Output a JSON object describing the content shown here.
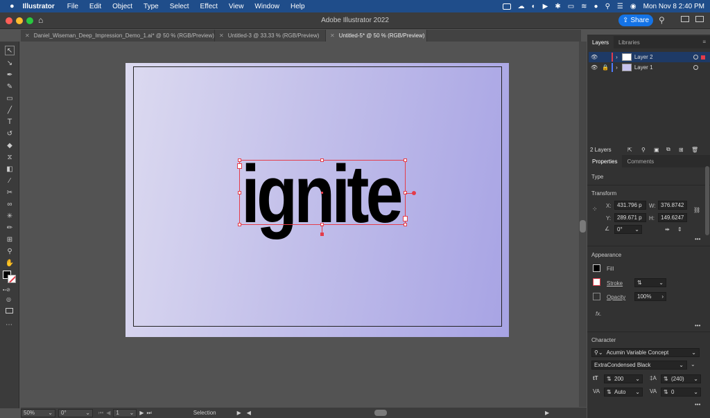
{
  "menubar": {
    "app_name": "Illustrator",
    "items": [
      "File",
      "Edit",
      "Object",
      "Type",
      "Select",
      "Effect",
      "View",
      "Window",
      "Help"
    ],
    "clock": "Mon Nov 8  2:40 PM"
  },
  "window": {
    "title": "Adobe Illustrator 2022",
    "share_label": "Share"
  },
  "tabs": [
    {
      "label": "Daniel_Wiseman_Deep_Impression_Demo_1.ai* @ 50 % (RGB/Preview)"
    },
    {
      "label": "Untitled-3 @ 33.33 % (RGB/Preview)"
    },
    {
      "label": "Untitled-5* @ 50 % (RGB/Preview)"
    }
  ],
  "canvas": {
    "text": "ignite",
    "colors": {
      "gradient_start": "#dcdaf0",
      "gradient_end": "#a7a3e4",
      "selection": "#e43c4a"
    }
  },
  "status": {
    "zoom": "50%",
    "rotation": "0°",
    "artboard": "1",
    "tool": "Selection"
  },
  "layers_panel": {
    "tabs": [
      "Layers",
      "Libraries"
    ],
    "layers": [
      {
        "name": "Layer 2",
        "color": "#e43c4a"
      },
      {
        "name": "Layer 1",
        "color": "#4f7bff"
      }
    ],
    "count": "2 Layers"
  },
  "properties_panel": {
    "tabs": [
      "Properties",
      "Comments"
    ],
    "type_heading": "Type",
    "transform": {
      "heading": "Transform",
      "x_label": "X:",
      "x": "431.796 p",
      "y_label": "Y:",
      "y": "289.671 p",
      "w_label": "W:",
      "w": "376.8742",
      "h_label": "H:",
      "h": "149.6247",
      "rotate": "0°"
    },
    "appearance": {
      "heading": "Appearance",
      "fill": "Fill",
      "stroke": "Stroke",
      "opacity_label": "Opacity",
      "opacity": "100%",
      "fx": "fx."
    },
    "character": {
      "heading": "Character",
      "font": "Acumin Variable Concept",
      "style": "ExtraCondensed Black",
      "size": "200",
      "leading": "(240)",
      "kerning": "Auto",
      "tracking": "0"
    }
  }
}
